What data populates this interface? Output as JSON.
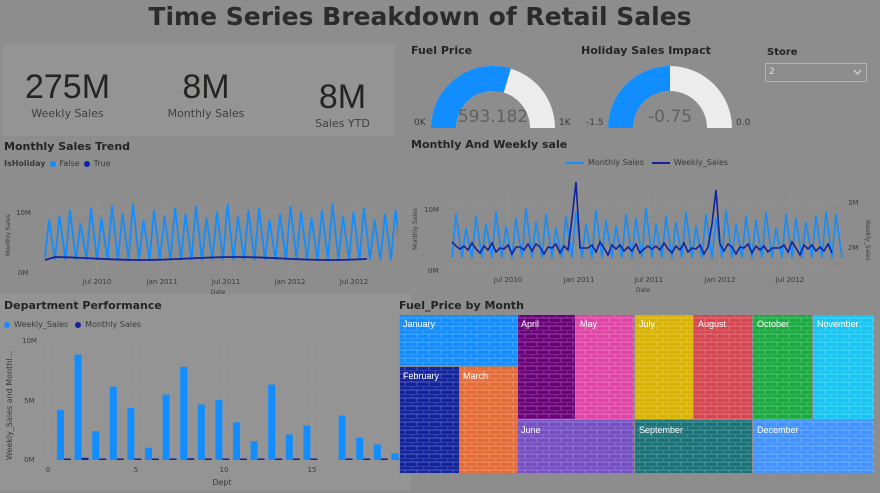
{
  "title": "Time Series Breakdown of Retail Sales",
  "colors": {
    "light_blue": "#118dff",
    "dark_blue": "#12239e",
    "bg": "#8d8d8d"
  },
  "cards": [
    {
      "value": "275M",
      "label": "Weekly Sales"
    },
    {
      "value": "8M",
      "label": "Monthly Sales"
    },
    {
      "value": "8M",
      "label": "Sales YTD"
    }
  ],
  "gauges": {
    "fuel": {
      "title": "Fuel Price",
      "value": "593.182",
      "min": "0K",
      "max": "1K",
      "fraction": 0.593
    },
    "holiday": {
      "title": "Holiday Sales Impact",
      "value": "-0.75",
      "min": "-1.5",
      "max": "0.0",
      "fraction": 0.5
    }
  },
  "store": {
    "label": "Store",
    "selected": "2"
  },
  "monthly_trend": {
    "title": "Monthly Sales Trend",
    "legend_title": "IsHoliday",
    "legend": [
      "False",
      "True"
    ],
    "y_ticks": [
      "10M",
      "0M"
    ],
    "y_label": "Monthly Sales",
    "x_ticks": [
      "Jul 2010",
      "Jan 2011",
      "Jul 2011",
      "Jan 2012",
      "Jul 2012"
    ],
    "x_label": "Date"
  },
  "monthly_weekly": {
    "title": "Monthly And Weekly sale",
    "legend": [
      "Monthly Sales",
      "Weekly_Sales"
    ],
    "y_ticks_left": [
      "10M",
      "0M"
    ],
    "y_ticks_right": [
      "3M",
      "2M"
    ],
    "y_label_left": "Monthly Sales",
    "y_label_right": "Weekly_Sales",
    "x_ticks": [
      "Jul 2010",
      "Jan 2011",
      "Jul 2011",
      "Jan 2012",
      "Jul 2012"
    ],
    "x_label": "Date"
  },
  "dept": {
    "title": "Department Performance",
    "legend": [
      "Weekly_Sales",
      "Monthly Sales"
    ],
    "y_ticks": [
      "10M",
      "5M",
      "0M"
    ],
    "y_label": "Weekly_Sales and Monthl...",
    "x_ticks": [
      "0",
      "5",
      "10",
      "15"
    ],
    "x_label": "Dept"
  },
  "treemap": {
    "title": "Fuel_Price by Month",
    "months": [
      "January",
      "February",
      "March",
      "April",
      "May",
      "July",
      "August",
      "June",
      "October",
      "November",
      "September",
      "December"
    ]
  },
  "chart_data": [
    {
      "type": "bar",
      "title": "Department Performance",
      "xlabel": "Dept",
      "ylabel": "Weekly_Sales and Monthl...",
      "ylim": [
        0,
        11
      ],
      "categories": [
        1,
        2,
        3,
        4,
        5,
        6,
        7,
        8,
        9,
        10,
        11,
        12,
        13,
        14,
        15,
        16,
        17,
        18,
        19,
        20
      ],
      "series": [
        {
          "name": "Weekly_Sales",
          "values": [
            4.5,
            9.5,
            2.6,
            6.6,
            4.7,
            1.1,
            5.9,
            8.4,
            5.0,
            5.4,
            3.4,
            1.7,
            6.8,
            2.3,
            3.1,
            0,
            4.0,
            2.0,
            1.4,
            0.6
          ]
        },
        {
          "name": "Monthly Sales",
          "values": [
            0.1,
            0.2,
            0.05,
            0.1,
            0.1,
            0.02,
            0.1,
            0.15,
            0.1,
            0.1,
            0.07,
            0.03,
            0.12,
            0.05,
            0.06,
            0,
            0.08,
            0.04,
            0.03,
            0.01
          ]
        }
      ]
    }
  ]
}
